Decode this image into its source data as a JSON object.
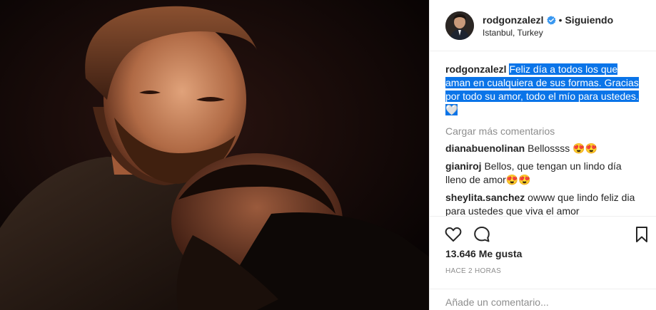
{
  "post": {
    "image_alt": "",
    "header": {
      "username": "rodgonzalezl",
      "separator": "•",
      "follow_status": "Siguiendo",
      "location": "Istanbul, Turkey"
    },
    "caption": {
      "username": "rodgonzalezl",
      "text": "Feliz día a todos los que aman en cualquiera de sus formas. Gracias por todo su amor, todo el mío para ustedes. 🤍"
    },
    "load_more": "Cargar más comentarios",
    "comments": [
      {
        "username": "dianabuenolinan",
        "text": "Bellossss 😍😍"
      },
      {
        "username": "gianiroj",
        "text": "Bellos, que tengan un lindo día lleno de amor😍😍"
      },
      {
        "username": "sheylita.sanchez",
        "text": "owww que lindo feliz dia para ustedes que viva el amor"
      }
    ],
    "likes": "13.646 Me gusta",
    "time": "HACE 2 HORAS",
    "comment_placeholder": "Añade un comentario...",
    "icons": {
      "like": "heart-icon",
      "comment": "comment-icon",
      "save": "bookmark-icon",
      "verified": "verified-badge-icon"
    },
    "colors": {
      "selection": "#0a74e8",
      "verified": "#3897f0",
      "muted": "#8e8e8e"
    }
  }
}
